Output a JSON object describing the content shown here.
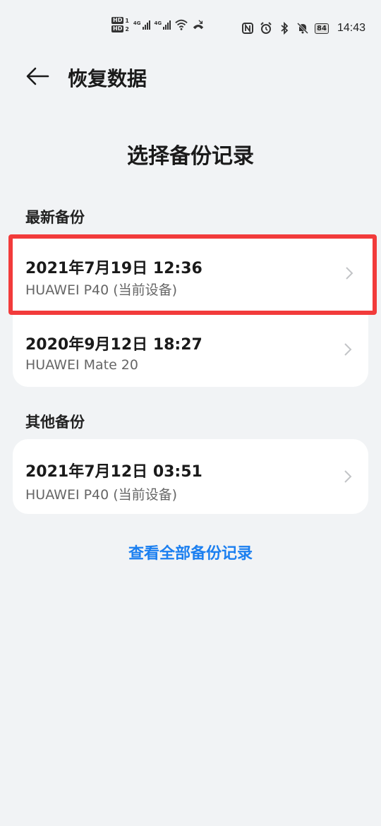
{
  "status_bar": {
    "hd1": "HD",
    "hd1_num": "1",
    "hd2": "HD",
    "hd2_num": "2",
    "net1": "4G",
    "net2": "4G",
    "battery": "84",
    "time": "14:43"
  },
  "app_bar": {
    "title": "恢复数据"
  },
  "page": {
    "title": "选择备份记录"
  },
  "latest": {
    "label": "最新备份",
    "items": [
      {
        "date": "2021年7月19日 12:36",
        "device": "HUAWEI P40 (当前设备)"
      },
      {
        "date": "2020年9月12日 18:27",
        "device": "HUAWEI Mate 20"
      }
    ]
  },
  "other": {
    "label": "其他备份",
    "items": [
      {
        "date": "2021年7月12日 03:51",
        "device": "HUAWEI P40 (当前设备)"
      }
    ]
  },
  "view_all": "查看全部备份记录",
  "colors": {
    "background": "#f1f3f5",
    "card": "#ffffff",
    "accent": "#1b7ff0",
    "highlight": "#f23b3b"
  }
}
